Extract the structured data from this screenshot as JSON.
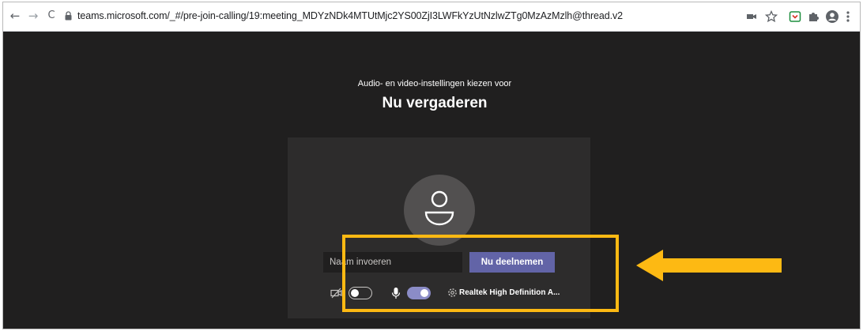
{
  "browser": {
    "url": "teams.microsoft.com/_#/pre-join-calling/19:meeting_MDYzNDk4MTUtMjc2YS00ZjI3LWFkYzUtNzlwZTg0MzAzMzlh@thread.v2",
    "back_icon": "←",
    "forward_icon": "→",
    "reload_icon": "C"
  },
  "teams": {
    "subtitle": "Audio- en video-instellingen kiezen voor",
    "title": "Nu vergaderen",
    "name_placeholder": "Naam invoeren",
    "join_label": "Nu deelnemen",
    "camera_on": false,
    "mic_on": true,
    "audio_device": "Realtek High Definition A..."
  },
  "annotation": {
    "color": "#fdb913"
  }
}
